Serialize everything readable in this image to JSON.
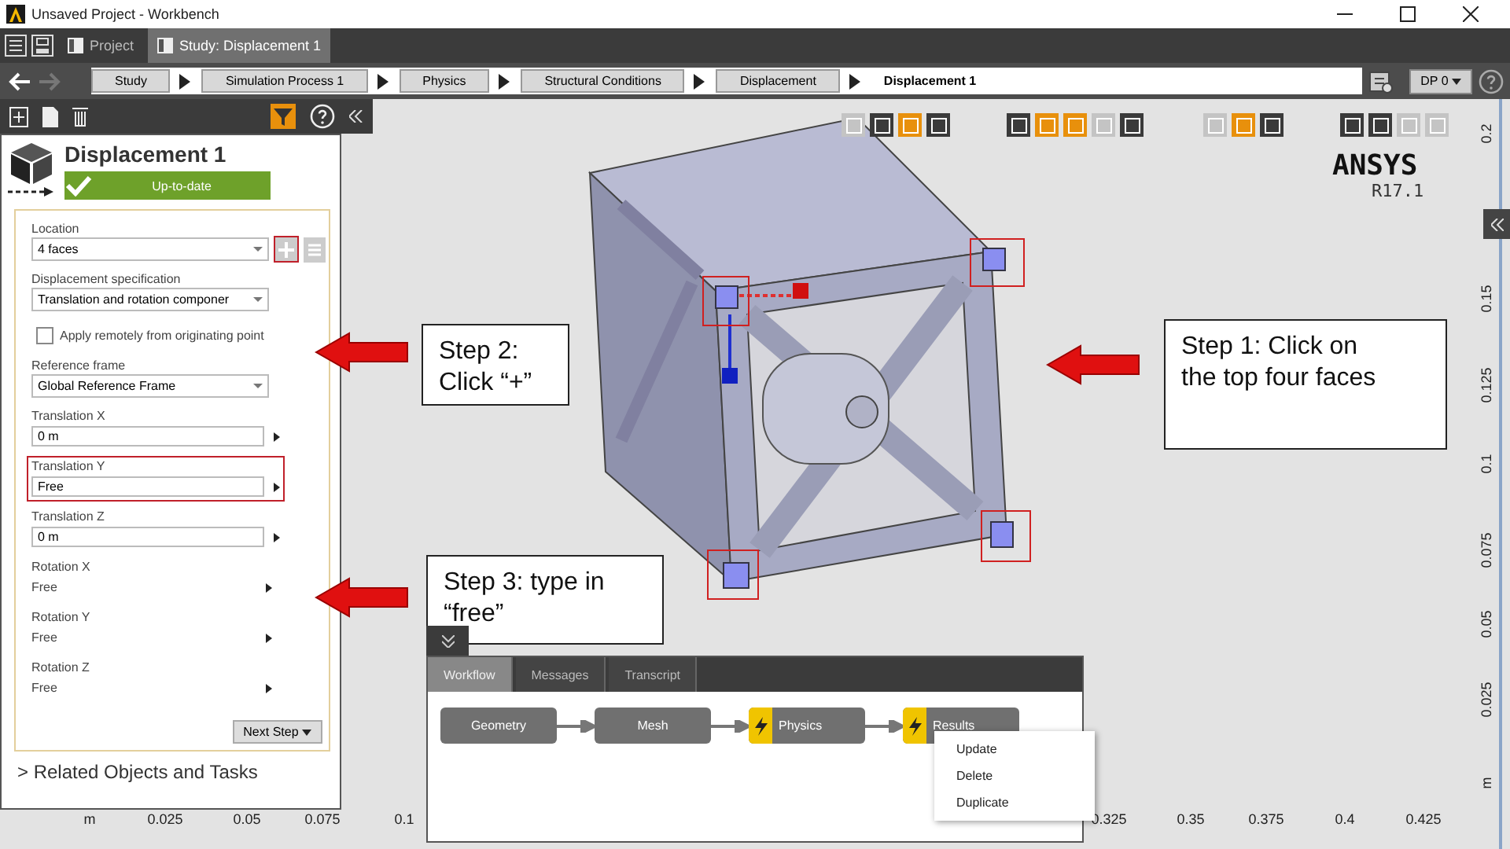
{
  "window": {
    "title": "Unsaved Project - Workbench"
  },
  "tabs": [
    {
      "label": "Project",
      "selected": false
    },
    {
      "label": "Study: Displacement 1",
      "selected": true
    }
  ],
  "breadcrumbs": [
    {
      "label": "Study"
    },
    {
      "label": "Simulation Process 1"
    },
    {
      "label": "Physics"
    },
    {
      "label": "Structural Conditions"
    },
    {
      "label": "Displacement"
    }
  ],
  "current_location": "Displacement 1",
  "design_point": "DP 0",
  "panel": {
    "title": "Displacement 1",
    "status": "Up-to-date",
    "fields": [
      {
        "kind": "dropdown",
        "label": "Location",
        "value": "4 faces",
        "highlighted": false,
        "add_highlighted": true
      },
      {
        "kind": "dropdown",
        "label": "Displacement specification",
        "value": "Translation and rotation componer",
        "highlighted": false
      },
      {
        "kind": "checkbox",
        "label": "Apply remotely from originating point",
        "checked": false
      },
      {
        "kind": "dropdown",
        "label": "Reference frame",
        "value": "Global Reference Frame",
        "highlighted": false
      },
      {
        "kind": "input",
        "label": "Translation X",
        "value": "0 m",
        "highlighted": false
      },
      {
        "kind": "input",
        "label": "Translation Y",
        "value": "Free",
        "highlighted": true
      },
      {
        "kind": "input",
        "label": "Translation Z",
        "value": "0 m",
        "highlighted": false
      },
      {
        "kind": "value",
        "label": "Rotation X",
        "value": "Free",
        "highlighted": false
      },
      {
        "kind": "value",
        "label": "Rotation Y",
        "value": "Free",
        "highlighted": false
      },
      {
        "kind": "value",
        "label": "Rotation Z",
        "value": "Free",
        "highlighted": false
      }
    ],
    "next_button": "Next Step",
    "related": "> Related Objects and Tasks"
  },
  "toolbar": [
    [
      {
        "active": false,
        "disabled": true
      },
      {
        "active": false,
        "disabled": false
      },
      {
        "active": true,
        "disabled": false
      },
      {
        "active": false,
        "disabled": false
      }
    ],
    [
      {
        "active": false,
        "disabled": false
      },
      {
        "active": true,
        "disabled": false
      },
      {
        "active": true,
        "disabled": false
      },
      {
        "active": false,
        "disabled": true
      },
      {
        "active": false,
        "disabled": false
      }
    ],
    [
      {
        "active": false,
        "disabled": true
      },
      {
        "active": true,
        "disabled": false
      },
      {
        "active": false,
        "disabled": false
      }
    ],
    [
      {
        "active": false,
        "disabled": false
      },
      {
        "active": false,
        "disabled": false
      },
      {
        "active": false,
        "disabled": true
      },
      {
        "active": false,
        "disabled": true
      }
    ]
  ],
  "logo": {
    "name": "ANSYS",
    "version": "R17.1"
  },
  "callouts": [
    {
      "text": "Step 2:\nClick “+”"
    },
    {
      "text": "Step 1: Click on\nthe top four faces"
    },
    {
      "text": "Step 3: type in\n“free”"
    }
  ],
  "ruler_vertical": [
    "0.2",
    "0.15",
    "0.125",
    "0.1",
    "0.075",
    "0.05",
    "0.025",
    "m"
  ],
  "ruler_horizontal": [
    "m",
    "0.025",
    "0.05",
    "0.075",
    "0.1",
    "0.325",
    "0.35",
    "0.375",
    "0.4",
    "0.425"
  ],
  "workflow": {
    "tabs": [
      {
        "label": "Workflow",
        "selected": true
      },
      {
        "label": "Messages",
        "selected": false
      },
      {
        "label": "Transcript",
        "selected": false
      }
    ],
    "steps": [
      {
        "label": "Geometry",
        "flagged": false
      },
      {
        "label": "Mesh",
        "flagged": false
      },
      {
        "label": "Physics",
        "flagged": true
      },
      {
        "label": "Results",
        "flagged": true
      }
    ],
    "context_menu": [
      "Update",
      "Delete",
      "Duplicate"
    ]
  }
}
